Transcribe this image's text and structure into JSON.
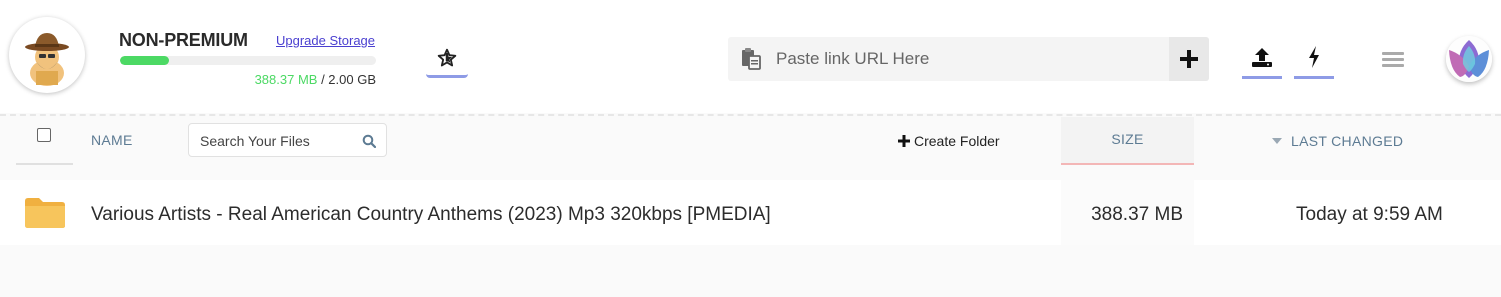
{
  "account": {
    "plan_label": "NON-PREMIUM",
    "upgrade_label": "Upgrade Storage",
    "storage_used": "388.37 MB",
    "storage_separator": " / ",
    "storage_total": "2.00 GB",
    "storage_fraction": 0.19
  },
  "toolbar": {
    "favorites_icon": "star-icon",
    "paste_placeholder": "Paste link URL Here",
    "add_icon": "plus-icon",
    "upload_icon": "upload-icon",
    "remote_icon": "lightning-icon",
    "menu_icon": "hamburger-menu-icon"
  },
  "table": {
    "name_header": "NAME",
    "search_placeholder": "Search Your Files",
    "create_folder_label": "Create Folder",
    "size_header": "SIZE",
    "last_changed_header": "LAST CHANGED",
    "rows": [
      {
        "name": "Various Artists - Real American Country Anthems (2023) Mp3 320kbps [PMEDIA]",
        "size": "388.37 MB",
        "changed": "Today at 9:59 AM",
        "type": "folder"
      }
    ]
  },
  "colors": {
    "accent": "#8e9be6",
    "storage_fill": "#4cd964",
    "link": "#4a3fd0",
    "header_text": "#5d7b93",
    "folder": "#f5b94c",
    "size_underline": "#f3b6b6"
  }
}
